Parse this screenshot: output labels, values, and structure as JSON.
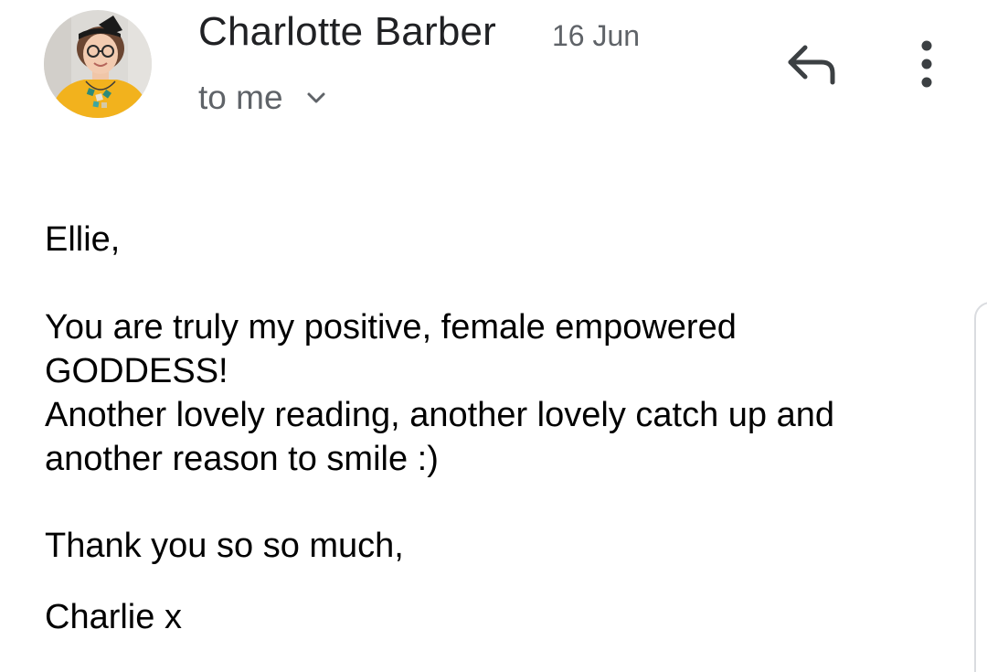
{
  "message": {
    "sender": {
      "name": "Charlotte Barber",
      "avatar_icon": "profile-photo"
    },
    "date": "16 Jun",
    "recipients": {
      "label": "to me",
      "expand_icon": "chevron-down-icon"
    },
    "actions": {
      "reply_icon": "reply-icon",
      "more_icon": "more-vert-icon"
    },
    "body": {
      "greeting": "Ellie,",
      "line_1": "You are truly my positive, female empowered",
      "line_2": "GODDESS!",
      "line_3": "Another lovely reading, another lovely catch up and",
      "line_4": "another reason to smile :)",
      "closing": "Thank you so so much,",
      "signature": "Charlie x"
    }
  },
  "colors": {
    "primary_text": "#202124",
    "secondary_text": "#5f6368",
    "body_text": "#000000",
    "icon": "#5f6368",
    "avatar_background": "#dcdad6",
    "avatar_sweater": "#f2b21d"
  }
}
